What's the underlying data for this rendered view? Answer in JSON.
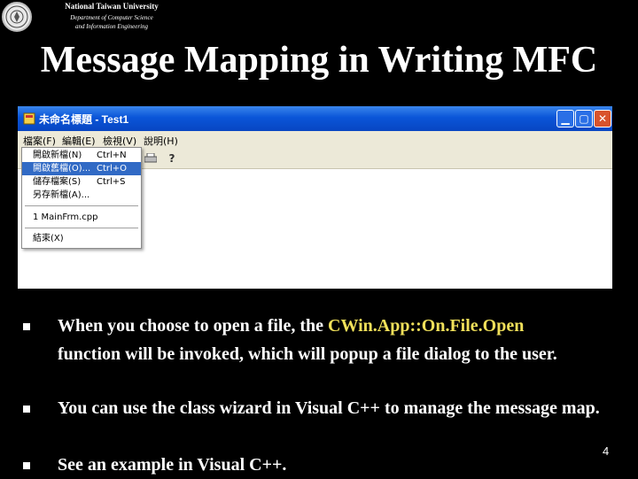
{
  "header": {
    "university": "National Taiwan University",
    "department_line1": "Department of Computer Science",
    "department_line2": "and Information Engineering"
  },
  "slide": {
    "title": "Message Mapping in Writing MFC",
    "page_number": "4"
  },
  "window": {
    "title": "未命名標題 - Test1",
    "buttons": {
      "minimize": "▁",
      "maximize": "▢",
      "close": "✕"
    },
    "menu": [
      "檔案(F)",
      "編輯(E)",
      "檢視(V)",
      "說明(H)"
    ],
    "file_menu": [
      {
        "label": "開啟新檔(N)",
        "shortcut": "Ctrl+N"
      },
      {
        "label": "開啟舊檔(O)...",
        "shortcut": "Ctrl+O"
      },
      {
        "label": "儲存檔案(S)",
        "shortcut": "Ctrl+S"
      },
      {
        "label": "另存新檔(A)...",
        "shortcut": ""
      },
      {
        "label": "1 MainFrm.cpp",
        "shortcut": ""
      },
      {
        "label": "結束(X)",
        "shortcut": ""
      }
    ],
    "toolbar_icons": [
      "print-icon",
      "help-icon"
    ],
    "help_glyph": "?"
  },
  "bullets": {
    "b1": {
      "before": "When you choose to open a file, the ",
      "highlight": "CWin.App::On.File.Open",
      "after": "function will be invoked, which will popup a file dialog to the user."
    },
    "b2": "You can use the class wizard in Visual C++ to manage the message map.",
    "b3": "See an example in Visual C++."
  },
  "colors": {
    "highlight": "#f0e05a",
    "selection": "#316ac5",
    "titlebar": "#0a55d8"
  }
}
